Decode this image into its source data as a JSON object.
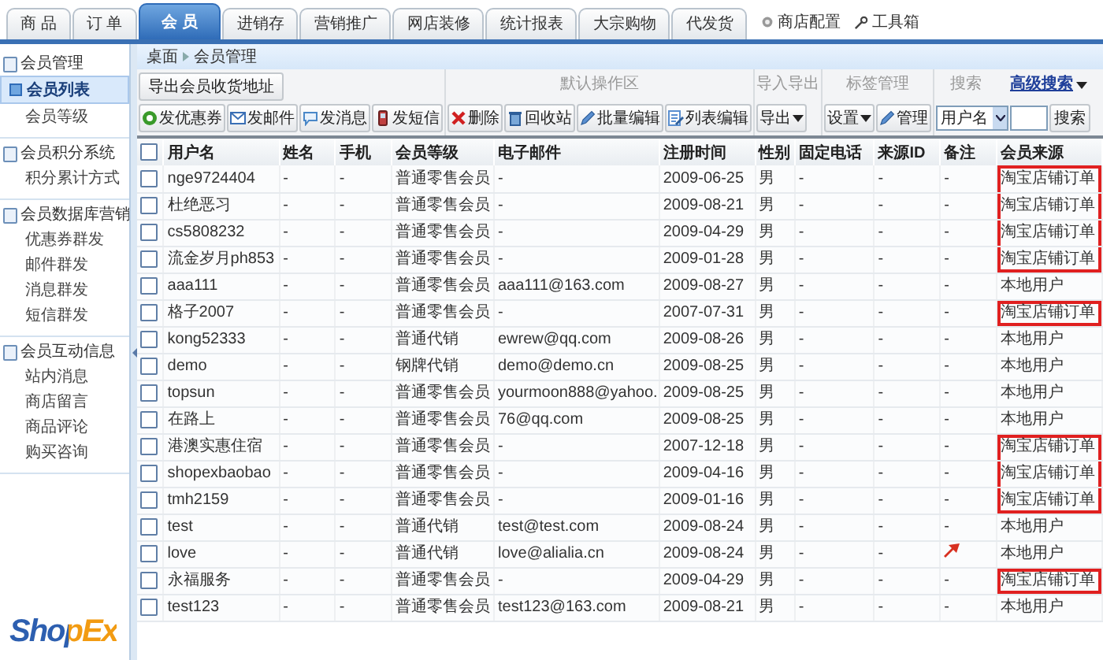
{
  "tabs": [
    {
      "label": "商 品",
      "selected": false
    },
    {
      "label": "订 单",
      "selected": false
    },
    {
      "label": "会 员",
      "selected": true
    },
    {
      "label": "进销存",
      "selected": false
    },
    {
      "label": "营销推广",
      "selected": false
    },
    {
      "label": "网店装修",
      "selected": false
    },
    {
      "label": "统计报表",
      "selected": false
    },
    {
      "label": "大宗购物",
      "selected": false
    },
    {
      "label": "代发货",
      "selected": false
    }
  ],
  "top_links": [
    {
      "label": "商店配置",
      "kind": "gear"
    },
    {
      "label": "工具箱",
      "kind": "tool"
    }
  ],
  "sidebar": {
    "groups": [
      {
        "title": "会员管理",
        "children": [
          {
            "label": "会员列表",
            "selected": true
          },
          {
            "label": "会员等级",
            "selected": false
          }
        ]
      },
      {
        "title": "会员积分系统",
        "children": [
          {
            "label": "积分累计方式",
            "selected": false
          }
        ]
      },
      {
        "title": "会员数据库营销",
        "children": [
          {
            "label": "优惠券群发",
            "selected": false
          },
          {
            "label": "邮件群发",
            "selected": false
          },
          {
            "label": "消息群发",
            "selected": false
          },
          {
            "label": "短信群发",
            "selected": false
          }
        ]
      },
      {
        "title": "会员互动信息",
        "children": [
          {
            "label": "站内消息",
            "selected": false
          },
          {
            "label": "商店留言",
            "selected": false
          },
          {
            "label": "商品评论",
            "selected": false
          },
          {
            "label": "购买咨询",
            "selected": false
          }
        ]
      }
    ],
    "logo": "ShopEx"
  },
  "breadcrumb": [
    "桌面",
    "会员管理"
  ],
  "toolbar": {
    "export_address_button": "导出会员收货地址",
    "send_buttons": [
      "发优惠券",
      "发邮件",
      "发消息",
      "发短信"
    ],
    "default_group": {
      "title": "默认操作区",
      "buttons": [
        "删除",
        "回收站",
        "批量编辑",
        "列表编辑"
      ]
    },
    "import_export_group": {
      "title": "导入导出",
      "dropdown": "导出"
    },
    "tag_group": {
      "title": "标签管理",
      "dropdown": "设置",
      "button": "管理"
    },
    "search_group": {
      "title": "搜索",
      "advanced_link": "高级搜索",
      "field_select": "用户名",
      "button": "搜索"
    }
  },
  "table": {
    "all_checked": false,
    "columns": [
      "用户名",
      "姓名",
      "手机",
      "会员等级",
      "电子邮件",
      "注册时间",
      "性别",
      "固定电话",
      "来源ID",
      "备注",
      "会员来源"
    ],
    "rows": [
      {
        "checked": false,
        "flagged": false,
        "highlighted": true,
        "cells": [
          "nge9724404",
          "-",
          "-",
          "普通零售会员",
          "-",
          "2009-06-25",
          "男",
          "-",
          "-",
          "-",
          "淘宝店铺订单"
        ]
      },
      {
        "checked": false,
        "flagged": false,
        "highlighted": true,
        "cells": [
          "杜绝恶习",
          "-",
          "-",
          "普通零售会员",
          "-",
          "2009-08-21",
          "男",
          "-",
          "-",
          "-",
          "淘宝店铺订单"
        ]
      },
      {
        "checked": false,
        "flagged": false,
        "highlighted": true,
        "cells": [
          "cs5808232",
          "-",
          "-",
          "普通零售会员",
          "-",
          "2009-04-29",
          "男",
          "-",
          "-",
          "-",
          "淘宝店铺订单"
        ]
      },
      {
        "checked": false,
        "flagged": false,
        "highlighted": true,
        "cells": [
          "流金岁月ph853",
          "-",
          "-",
          "普通零售会员",
          "-",
          "2009-01-28",
          "男",
          "-",
          "-",
          "-",
          "淘宝店铺订单"
        ]
      },
      {
        "checked": false,
        "flagged": false,
        "highlighted": false,
        "cells": [
          "aaa111",
          "-",
          "-",
          "普通零售会员",
          "aaa111@163.com",
          "2009-08-27",
          "男",
          "-",
          "-",
          "-",
          "本地用户"
        ]
      },
      {
        "checked": false,
        "flagged": false,
        "highlighted": true,
        "cells": [
          "格子2007",
          "-",
          "-",
          "普通零售会员",
          "-",
          "2007-07-31",
          "男",
          "-",
          "-",
          "-",
          "淘宝店铺订单"
        ]
      },
      {
        "checked": false,
        "flagged": false,
        "highlighted": false,
        "cells": [
          "kong52333",
          "-",
          "-",
          "普通代销",
          "ewrew@qq.com",
          "2009-08-26",
          "男",
          "-",
          "-",
          "-",
          "本地用户"
        ]
      },
      {
        "checked": false,
        "flagged": false,
        "highlighted": false,
        "cells": [
          "demo",
          "-",
          "-",
          "钢牌代销",
          "demo@demo.cn",
          "2009-08-25",
          "男",
          "-",
          "-",
          "-",
          "本地用户"
        ]
      },
      {
        "checked": false,
        "flagged": false,
        "highlighted": false,
        "cells": [
          "topsun",
          "-",
          "-",
          "普通零售会员",
          "yourmoon888@yahoo.",
          "2009-08-25",
          "男",
          "-",
          "-",
          "-",
          "本地用户"
        ]
      },
      {
        "checked": false,
        "flagged": false,
        "highlighted": false,
        "cells": [
          "在路上",
          "-",
          "-",
          "普通零售会员",
          "76@qq.com",
          "2009-08-25",
          "男",
          "-",
          "-",
          "-",
          "本地用户"
        ]
      },
      {
        "checked": false,
        "flagged": false,
        "highlighted": true,
        "cells": [
          "港澳实惠住宿",
          "-",
          "-",
          "普通零售会员",
          "-",
          "2007-12-18",
          "男",
          "-",
          "-",
          "-",
          "淘宝店铺订单"
        ]
      },
      {
        "checked": false,
        "flagged": false,
        "highlighted": true,
        "cells": [
          "shopexbaobao",
          "-",
          "-",
          "普通零售会员",
          "-",
          "2009-04-16",
          "男",
          "-",
          "-",
          "-",
          "淘宝店铺订单"
        ]
      },
      {
        "checked": false,
        "flagged": false,
        "highlighted": true,
        "cells": [
          "tmh2159",
          "-",
          "-",
          "普通零售会员",
          "-",
          "2009-01-16",
          "男",
          "-",
          "-",
          "-",
          "淘宝店铺订单"
        ]
      },
      {
        "checked": false,
        "flagged": false,
        "highlighted": false,
        "cells": [
          "test",
          "-",
          "-",
          "普通代销",
          "test@test.com",
          "2009-08-24",
          "男",
          "-",
          "-",
          "-",
          "本地用户"
        ]
      },
      {
        "checked": false,
        "flagged": true,
        "highlighted": false,
        "cells": [
          "love",
          "-",
          "-",
          "普通代销",
          "love@alialia.cn",
          "2009-08-24",
          "男",
          "-",
          "-",
          "",
          "本地用户"
        ]
      },
      {
        "checked": false,
        "flagged": false,
        "highlighted": true,
        "cells": [
          "永福服务",
          "-",
          "-",
          "普通零售会员",
          "-",
          "2009-04-29",
          "男",
          "-",
          "-",
          "-",
          "淘宝店铺订单"
        ]
      },
      {
        "checked": false,
        "flagged": false,
        "highlighted": false,
        "cells": [
          "test123",
          "-",
          "-",
          "普通零售会员",
          "test123@163.com",
          "2009-08-21",
          "男",
          "-",
          "-",
          "-",
          "本地用户"
        ]
      }
    ]
  }
}
